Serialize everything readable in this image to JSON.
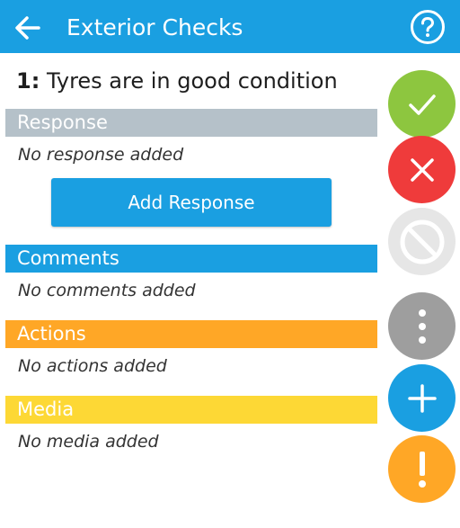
{
  "appbar": {
    "title": "Exterior Checks",
    "back_icon": "arrow-left-icon",
    "help_icon": "question-circle-icon",
    "color": "#1a9fe1"
  },
  "question": {
    "number": "1:",
    "text": "Tyres are in good condition"
  },
  "sections": {
    "response": {
      "label": "Response",
      "empty": "No response added",
      "color": "#b5c1c9"
    },
    "comments": {
      "label": "Comments",
      "empty": "No comments added",
      "color": "#1a9fe1"
    },
    "actions": {
      "label": "Actions",
      "empty": "No actions added",
      "color": "#ffa726"
    },
    "media": {
      "label": "Media",
      "empty": "No media added",
      "color": "#fdd835"
    }
  },
  "buttons": {
    "add_response": "Add Response"
  },
  "fabs": [
    {
      "name": "pass",
      "icon": "checkmark-icon",
      "color": "#8dc63f"
    },
    {
      "name": "fail",
      "icon": "close-icon",
      "color": "#ef3b3b"
    },
    {
      "name": "not-applicable",
      "icon": "block-icon",
      "color": "#e6e6e6"
    },
    {
      "name": "more",
      "icon": "more-vertical-icon",
      "color": "#9e9e9e"
    },
    {
      "name": "add",
      "icon": "plus-icon",
      "color": "#1a9fe1"
    },
    {
      "name": "alert",
      "icon": "exclamation-icon",
      "color": "#ffa726"
    }
  ]
}
